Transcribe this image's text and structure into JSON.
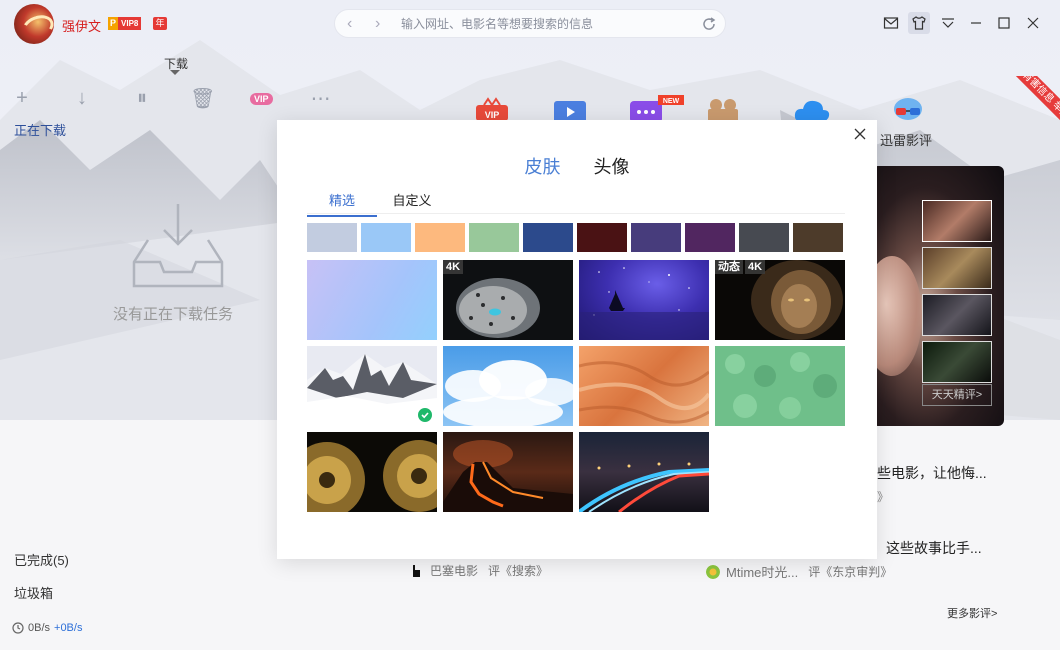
{
  "user": {
    "name": "强伊文",
    "vip_p": "P",
    "vip_level": "VIP8",
    "year_badge": "年"
  },
  "address_bar": {
    "placeholder": "输入网址、电影名等想要搜索的信息",
    "back": "‹",
    "forward": "›"
  },
  "window_controls": [
    "mail-icon",
    "skin-icon",
    "dropdown-icon",
    "minimize-icon",
    "maximize-icon",
    "close-icon"
  ],
  "sidebar": {
    "tab_label": "下载",
    "downloading": "正在下载",
    "empty_text": "没有正在下载任务",
    "completed": "已完成(5)",
    "trash": "垃圾箱",
    "speed_down": "0B/s",
    "speed_up": "+0B/s",
    "toolbar_vip": "VIP"
  },
  "content": {
    "app_label": "迅雷影评",
    "new_badge": "NEW",
    "hot_ribbon": "有害信息 举报",
    "more_review": "天天精评>",
    "article1_title": "些电影，让他悔...",
    "article1_sub": "》",
    "article2_title": "这些故事比手...",
    "source1_name": "巴塞电影",
    "source1_review": "评《搜索》",
    "source2_name": "Mtime时光...",
    "source2_review": "评《东京审判》",
    "more_reviews": "更多影评>"
  },
  "modal": {
    "tab_skin": "皮肤",
    "tab_avatar": "头像",
    "subtab_featured": "精选",
    "subtab_custom": "自定义",
    "swatches": [
      "#c2cce0",
      "#9ac8f7",
      "#fdb97e",
      "#98c89a",
      "#2c4a8c",
      "#4a1214",
      "#473c7c",
      "#512660",
      "#474a51",
      "#4d3b2a"
    ],
    "tiles": [
      {
        "name": "gradient-blue-purple",
        "tags": [],
        "selected": false
      },
      {
        "name": "snow-leopard",
        "tags": [
          "4K"
        ],
        "selected": false
      },
      {
        "name": "starry-sailboat",
        "tags": [],
        "selected": false
      },
      {
        "name": "lion-dark",
        "tags": [
          "动态",
          "4K"
        ],
        "selected": false
      },
      {
        "name": "snow-mountain",
        "tags": [],
        "selected": true
      },
      {
        "name": "cloudy-sky",
        "tags": [],
        "selected": false
      },
      {
        "name": "sand-canyon",
        "tags": [],
        "selected": false
      },
      {
        "name": "green-clover",
        "tags": [],
        "selected": false
      },
      {
        "name": "golden-gears",
        "tags": [],
        "selected": false
      },
      {
        "name": "volcano",
        "tags": [],
        "selected": false
      },
      {
        "name": "night-highway",
        "tags": [],
        "selected": false
      }
    ]
  }
}
